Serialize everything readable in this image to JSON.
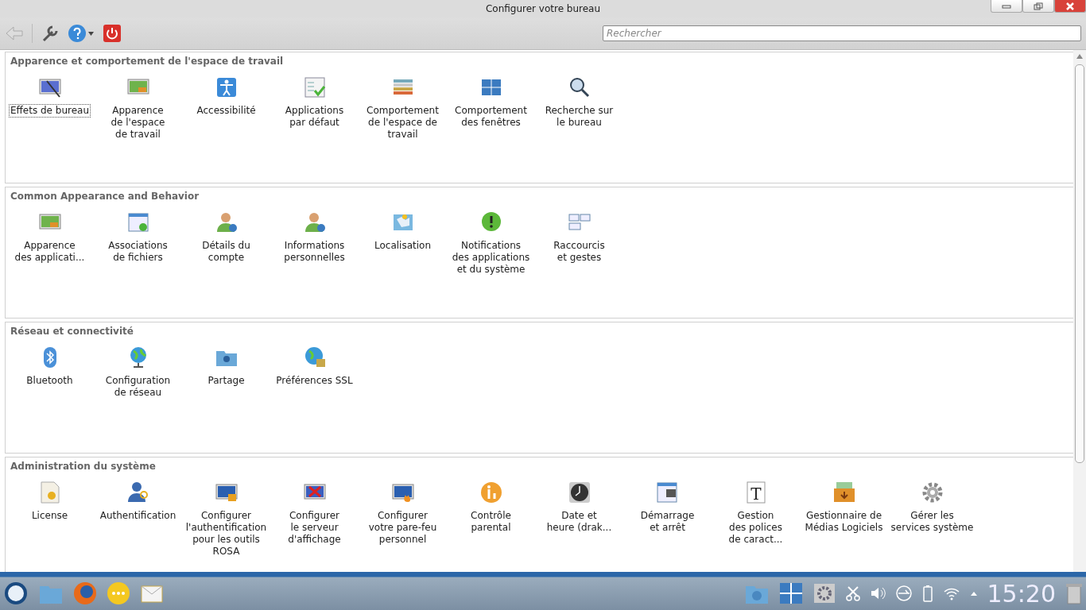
{
  "window": {
    "title": "Configurer votre bureau"
  },
  "search": {
    "placeholder": "Rechercher"
  },
  "sections": [
    {
      "title": "Apparence et comportement de l'espace de travail",
      "items": [
        {
          "label": "Effets de bureau",
          "selected": true
        },
        {
          "label": "Apparence\nde l'espace\nde travail",
          "selected": false
        },
        {
          "label": "Accessibilité",
          "selected": false
        },
        {
          "label": "Applications\npar défaut",
          "selected": false
        },
        {
          "label": "Comportement\nde l'espace de\ntravail",
          "selected": false
        },
        {
          "label": "Comportement\ndes fenêtres",
          "selected": false
        },
        {
          "label": "Recherche sur\nle bureau",
          "selected": false
        }
      ]
    },
    {
      "title": "Common Appearance and Behavior",
      "items": [
        {
          "label": "Apparence\ndes applicati...",
          "selected": false
        },
        {
          "label": "Associations\nde fichiers",
          "selected": false
        },
        {
          "label": "Détails du\ncompte",
          "selected": false
        },
        {
          "label": "Informations\npersonnelles",
          "selected": false
        },
        {
          "label": "Localisation",
          "selected": false
        },
        {
          "label": "Notifications\ndes applications\net du système",
          "selected": false
        },
        {
          "label": "Raccourcis\net gestes",
          "selected": false
        }
      ]
    },
    {
      "title": "Réseau et connectivité",
      "items": [
        {
          "label": "Bluetooth",
          "selected": false
        },
        {
          "label": "Configuration\nde réseau",
          "selected": false
        },
        {
          "label": "Partage",
          "selected": false
        },
        {
          "label": "Préférences SSL",
          "selected": false
        }
      ]
    },
    {
      "title": "Administration du système",
      "items": [
        {
          "label": "License",
          "selected": false
        },
        {
          "label": "Authentification",
          "selected": false
        },
        {
          "label": "Configurer\nl'authentification\npour les outils\nROSA",
          "selected": false
        },
        {
          "label": "Configurer\nle serveur\nd'affichage",
          "selected": false
        },
        {
          "label": "Configurer\nvotre pare-feu\npersonnel",
          "selected": false
        },
        {
          "label": "Contrôle\nparental",
          "selected": false
        },
        {
          "label": "Date et\nheure (drak...",
          "selected": false
        },
        {
          "label": "Démarrage\net arrêt",
          "selected": false
        },
        {
          "label": "Gestion\ndes polices\nde caract...",
          "selected": false,
          "glyph": "T"
        },
        {
          "label": "Gestionnaire de\nMédias Logiciels",
          "selected": false
        },
        {
          "label": "Gérer les\nservices système",
          "selected": false
        }
      ]
    }
  ],
  "taskbar": {
    "clock": "15:20"
  }
}
